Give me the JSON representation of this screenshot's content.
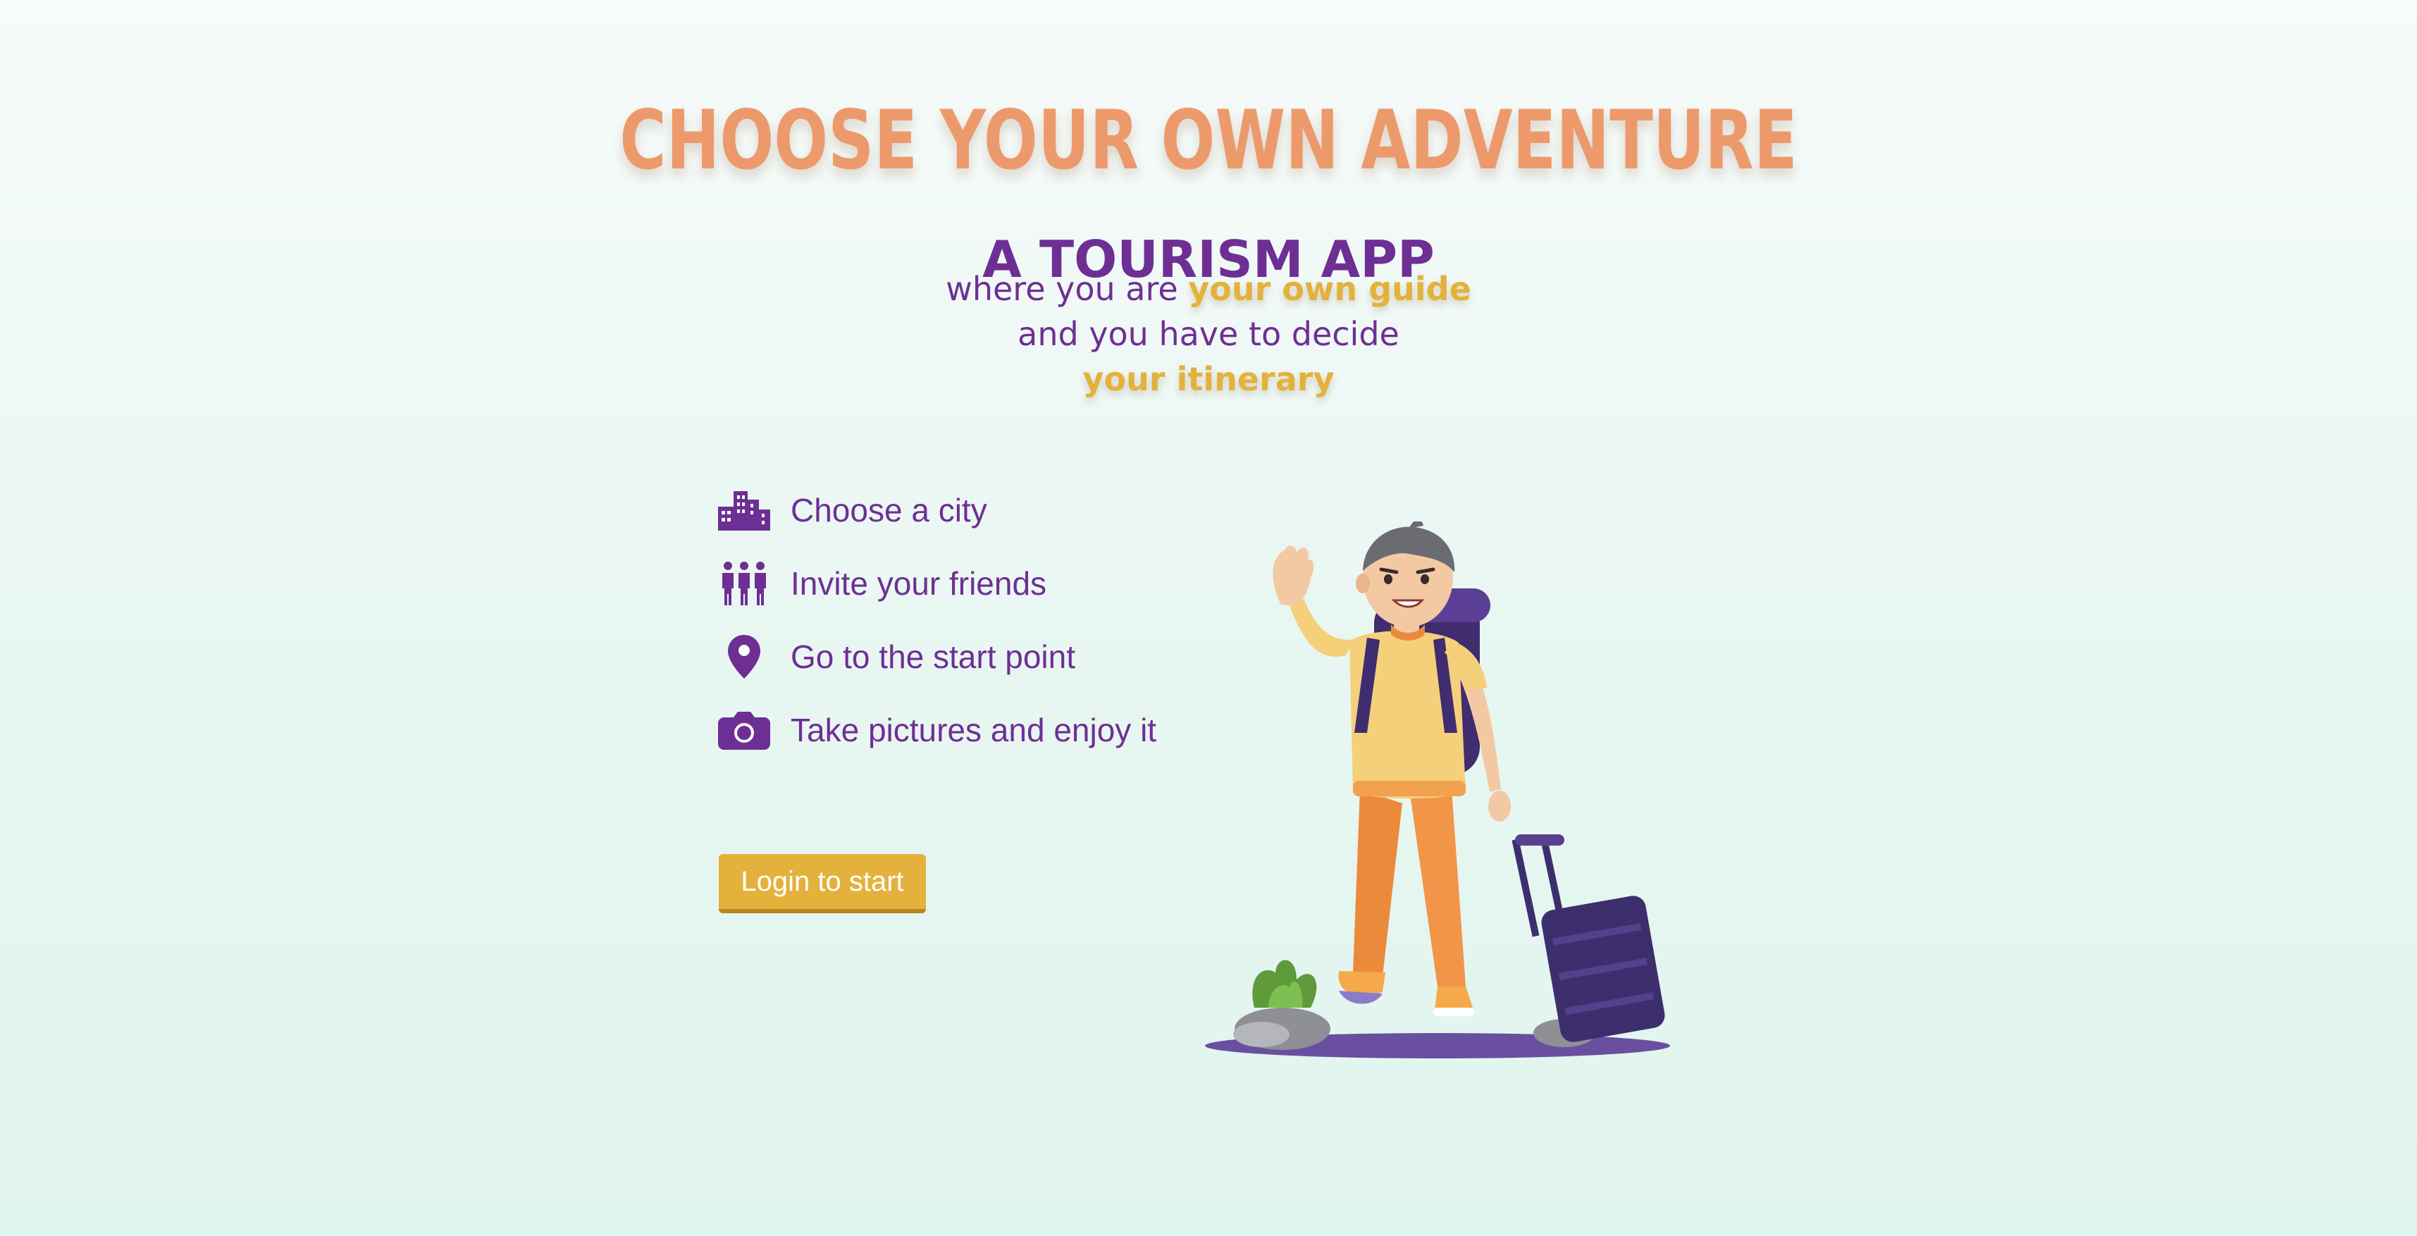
{
  "hero": {
    "headline": "CHOOSE YOUR OWN ADVENTURE",
    "app_title": "A TOURISM APP",
    "tagline": {
      "line1_prefix": "where you are ",
      "line1_highlight": "your own guide",
      "line2": "and you have to decide",
      "line3_highlight": "your itinerary"
    }
  },
  "features": [
    {
      "icon": "city-icon",
      "label": "Choose a city"
    },
    {
      "icon": "friends-icon",
      "label": "Invite your friends"
    },
    {
      "icon": "map-pin-icon",
      "label": "Go to the start point"
    },
    {
      "icon": "camera-icon",
      "label": "Take pictures and enjoy it"
    }
  ],
  "cta": {
    "login_label": "Login to start"
  },
  "colors": {
    "accent_orange": "#ec9a6c",
    "brand_purple": "#6e2f94",
    "highlight_yellow": "#e4b13c"
  }
}
